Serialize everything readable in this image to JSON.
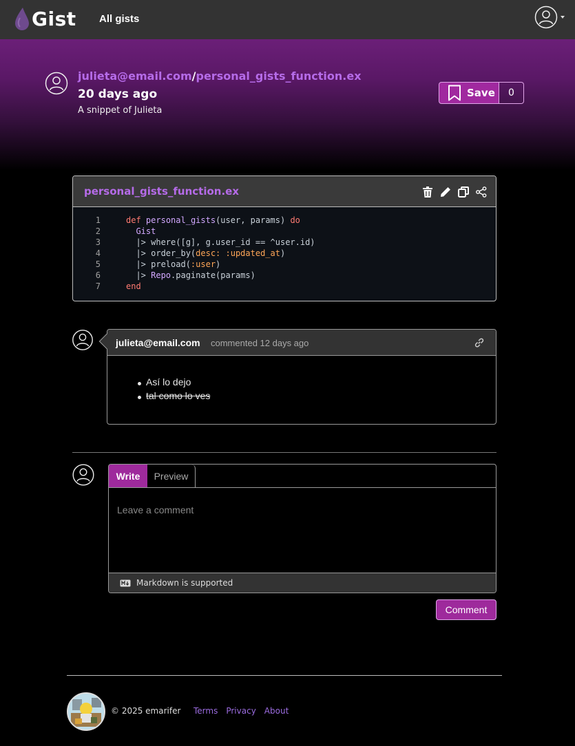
{
  "nav": {
    "brand": "Gist",
    "all_gists": "All gists"
  },
  "gist": {
    "owner": "julieta@email.com",
    "separator": "/",
    "filename": "personal_gists_function.ex",
    "updated": "20 days ago",
    "description": "A snippet of Julieta",
    "save_label": "Save",
    "save_count": "0"
  },
  "file": {
    "name": "personal_gists_function.ex",
    "line_numbers": [
      "1",
      "2",
      "3",
      "4",
      "5",
      "6",
      "7"
    ],
    "code": [
      [
        "def",
        " ",
        "personal_gists",
        "(user, params) ",
        "do"
      ],
      [
        "  ",
        "Gist"
      ],
      [
        "  |> where([g], g.user_id == ^user.id)"
      ],
      [
        "  |> order_by(",
        "desc: :updated_at",
        ")"
      ],
      [
        "  |> preload(",
        ":user",
        ")"
      ],
      [
        "  |> ",
        "Repo",
        ".paginate(params)"
      ],
      [
        "end"
      ]
    ]
  },
  "comment": {
    "author": "julieta@email.com",
    "meta": "commented 12 days ago",
    "items": [
      "Así lo dejo",
      "tal como lo ves"
    ]
  },
  "form": {
    "tab_write": "Write",
    "tab_preview": "Preview",
    "placeholder": "Leave a comment",
    "markdown_note": "Markdown is supported",
    "submit_label": "Comment"
  },
  "footer": {
    "copyright": "© 2025 emarifer",
    "links": [
      "Terms",
      "Privacy",
      "About"
    ]
  },
  "colors": {
    "accent": "#9e2a9c",
    "link": "#b56be8",
    "header_gradient_top": "#6b1f78"
  }
}
